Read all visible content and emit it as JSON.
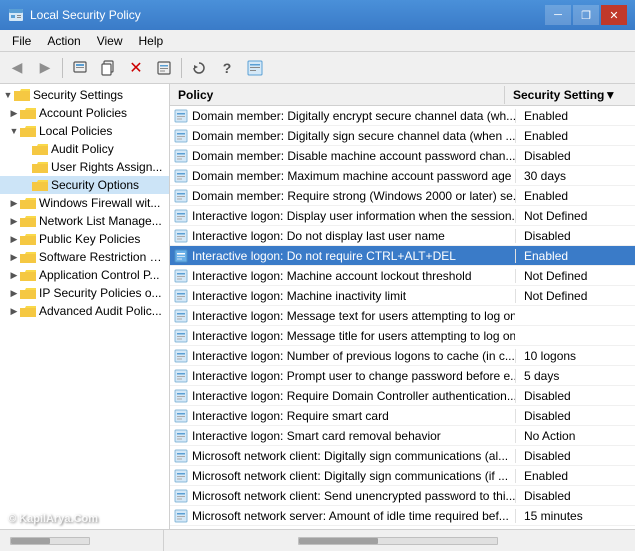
{
  "titleBar": {
    "title": "Local Security Policy",
    "minimizeLabel": "─",
    "restoreLabel": "❐",
    "closeLabel": "✕"
  },
  "menuBar": {
    "items": [
      "File",
      "Action",
      "View",
      "Help"
    ]
  },
  "toolbar": {
    "buttons": [
      "◀",
      "▶",
      "⬆",
      "📋",
      "✕",
      "📄",
      "🔄",
      "ℹ",
      "📑"
    ]
  },
  "tree": {
    "rootLabel": "Security Settings",
    "items": [
      {
        "label": "Account Policies",
        "level": 1,
        "expand": "▶",
        "selected": false
      },
      {
        "label": "Local Policies",
        "level": 1,
        "expand": "▼",
        "selected": false
      },
      {
        "label": "Audit Policy",
        "level": 2,
        "expand": "",
        "selected": false
      },
      {
        "label": "User Rights Assign...",
        "level": 2,
        "expand": "",
        "selected": false
      },
      {
        "label": "Security Options",
        "level": 2,
        "expand": "",
        "selected": true
      },
      {
        "label": "Windows Firewall wit...",
        "level": 1,
        "expand": "▶",
        "selected": false
      },
      {
        "label": "Network List Manage...",
        "level": 1,
        "expand": "▶",
        "selected": false
      },
      {
        "label": "Public Key Policies",
        "level": 1,
        "expand": "▶",
        "selected": false
      },
      {
        "label": "Software Restriction P...",
        "level": 1,
        "expand": "▶",
        "selected": false
      },
      {
        "label": "Application Control P...",
        "level": 1,
        "expand": "▶",
        "selected": false
      },
      {
        "label": "IP Security Policies o...",
        "level": 1,
        "expand": "▶",
        "selected": false
      },
      {
        "label": "Advanced Audit Polic...",
        "level": 1,
        "expand": "▶",
        "selected": false
      }
    ]
  },
  "table": {
    "columns": [
      "Policy",
      "Security Setting▼"
    ],
    "rows": [
      {
        "policy": "Domain member: Digitally encrypt secure channel data (wh...",
        "setting": "Enabled"
      },
      {
        "policy": "Domain member: Digitally sign secure channel data (when ...",
        "setting": "Enabled"
      },
      {
        "policy": "Domain member: Disable machine account password chan...",
        "setting": "Disabled"
      },
      {
        "policy": "Domain member: Maximum machine account password age",
        "setting": "30 days"
      },
      {
        "policy": "Domain member: Require strong (Windows 2000 or later) se...",
        "setting": "Enabled"
      },
      {
        "policy": "Interactive logon: Display user information when the session...",
        "setting": "Not Defined"
      },
      {
        "policy": "Interactive logon: Do not display last user name",
        "setting": "Disabled"
      },
      {
        "policy": "Interactive logon: Do not require CTRL+ALT+DEL",
        "setting": "Enabled",
        "selected": true
      },
      {
        "policy": "Interactive logon: Machine account lockout threshold",
        "setting": "Not Defined"
      },
      {
        "policy": "Interactive logon: Machine inactivity limit",
        "setting": "Not Defined"
      },
      {
        "policy": "Interactive logon: Message text for users attempting to log on",
        "setting": ""
      },
      {
        "policy": "Interactive logon: Message title for users attempting to log on",
        "setting": ""
      },
      {
        "policy": "Interactive logon: Number of previous logons to cache (in c...",
        "setting": "10 logons"
      },
      {
        "policy": "Interactive logon: Prompt user to change password before e...",
        "setting": "5 days"
      },
      {
        "policy": "Interactive logon: Require Domain Controller authentication...",
        "setting": "Disabled"
      },
      {
        "policy": "Interactive logon: Require smart card",
        "setting": "Disabled"
      },
      {
        "policy": "Interactive logon: Smart card removal behavior",
        "setting": "No Action"
      },
      {
        "policy": "Microsoft network client: Digitally sign communications (al...",
        "setting": "Disabled"
      },
      {
        "policy": "Microsoft network client: Digitally sign communications (if ...",
        "setting": "Enabled"
      },
      {
        "policy": "Microsoft network client: Send unencrypted password to thi...",
        "setting": "Disabled"
      },
      {
        "policy": "Microsoft network server: Amount of idle time required bef...",
        "setting": "15 minutes"
      }
    ]
  },
  "statusBar": {
    "leftLabel": "",
    "scrollLabel": "|||"
  },
  "watermark": "© KapilArya.Com"
}
